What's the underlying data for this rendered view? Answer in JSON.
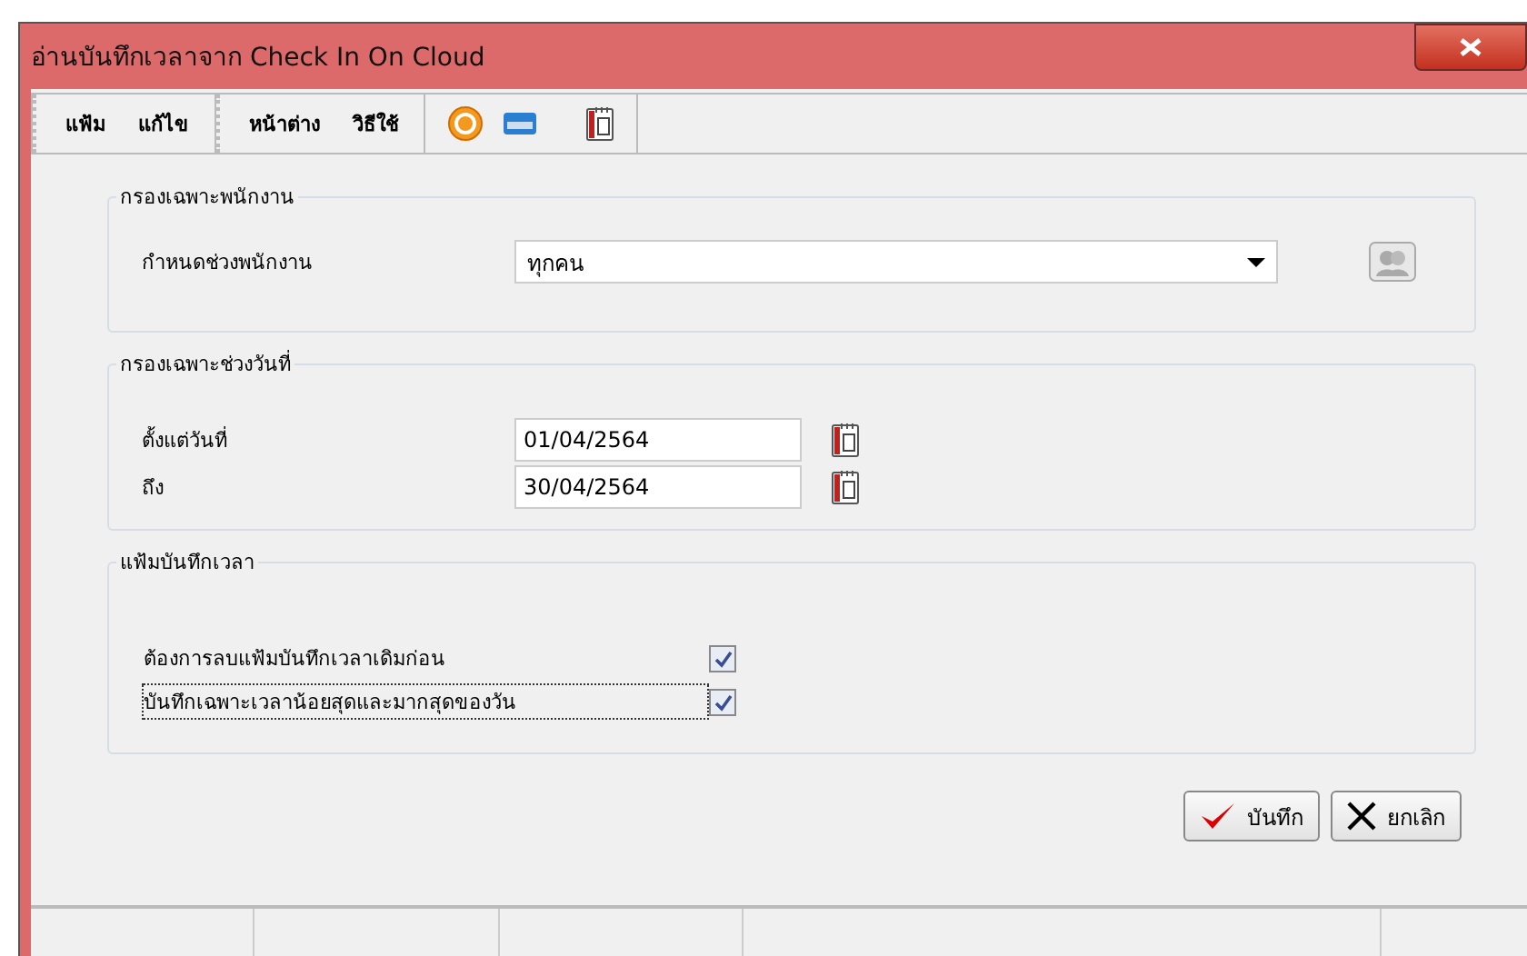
{
  "window": {
    "title": "อ่านบันทึกเวลาจาก Check In On Cloud"
  },
  "menu_groups": [
    [
      "แฟ้ม",
      "แก้ไข"
    ],
    [
      "หน้าต่าง",
      "วิธีใช้"
    ]
  ],
  "employee_filter": {
    "title": "กรองเฉพาะพนักงาน",
    "label": "กำหนดช่วงพนักงาน",
    "value": "ทุกคน"
  },
  "date_filter": {
    "title": "กรองเฉพาะช่วงวันที่",
    "fields": [
      {
        "label": "ตั้งแต่วันที่",
        "value": "01/04/2564"
      },
      {
        "label": "ถึง",
        "value": "30/04/2564"
      }
    ]
  },
  "time_file": {
    "title": "แฟ้มบันทึกเวลา",
    "options": [
      {
        "label": "ต้องการลบแฟ้มบันทึกเวลาเดิมก่อน",
        "checked": true,
        "focused": false
      },
      {
        "label": "บันทึกเฉพาะเวลาน้อยสุดและมากสุดของวัน",
        "checked": true,
        "focused": true
      }
    ]
  },
  "buttons": [
    {
      "kind": "save",
      "label": "บันทึก"
    },
    {
      "kind": "cancel",
      "label": "ยกเลิก"
    }
  ]
}
